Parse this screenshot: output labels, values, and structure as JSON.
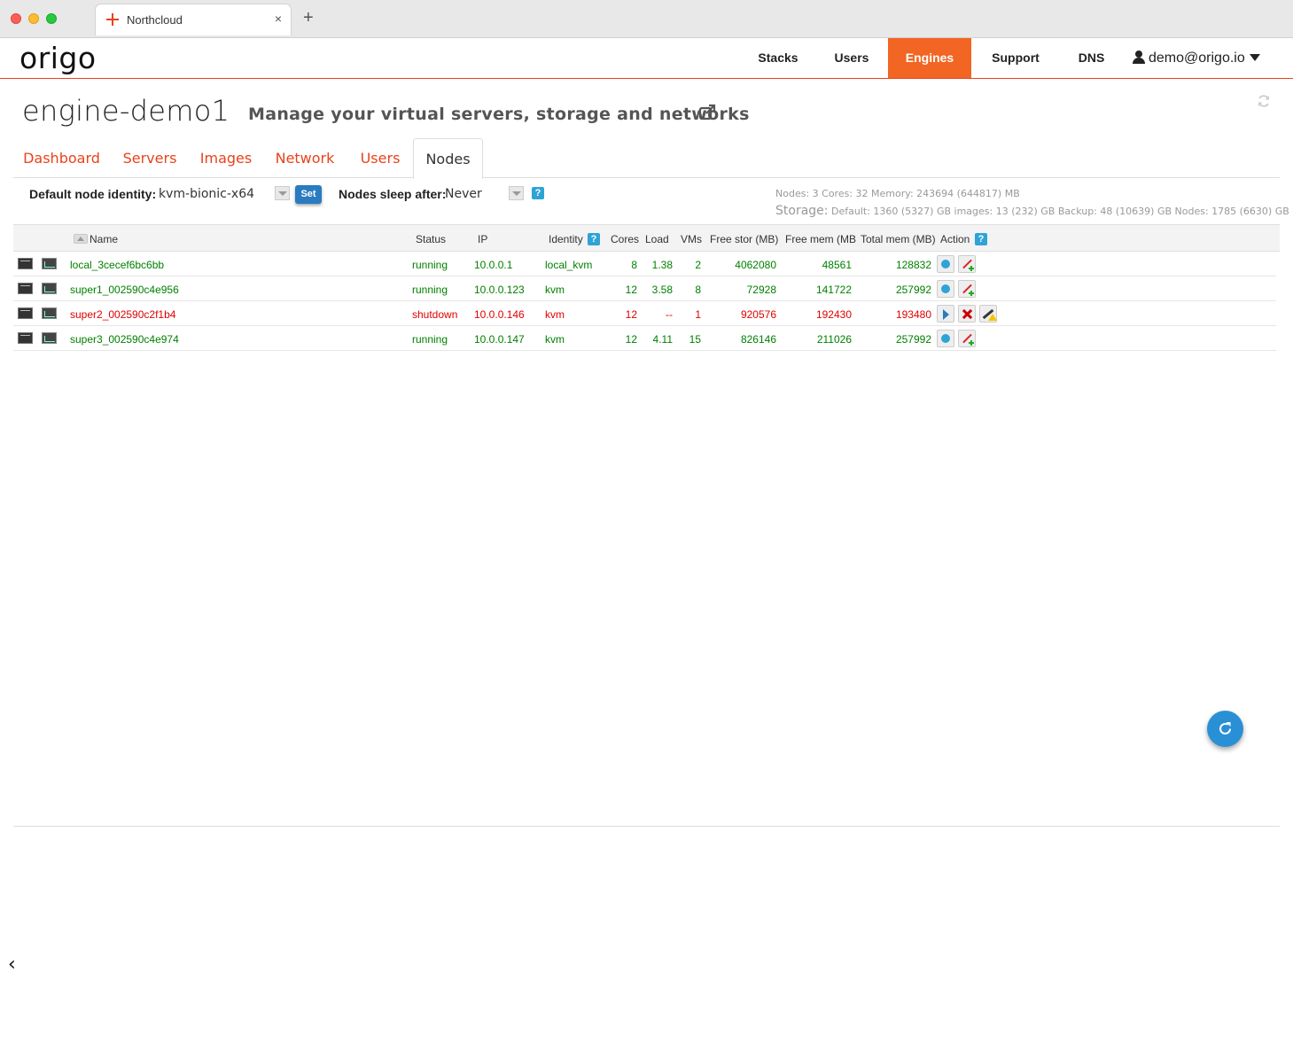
{
  "browser": {
    "tab_title": "Northcloud",
    "tab_close": "×",
    "new_tab": "+"
  },
  "header": {
    "logo": "origo",
    "nav": {
      "stacks": "Stacks",
      "users": "Users",
      "engines": "Engines",
      "support": "Support",
      "dns": "DNS",
      "account": "demo@origo.io"
    },
    "accent_color": "#f26522"
  },
  "page": {
    "title": "engine-demo1",
    "subtitle": "Manage your virtual servers, storage and networks"
  },
  "subtabs": {
    "dashboard": "Dashboard",
    "servers": "Servers",
    "images": "Images",
    "network": "Network",
    "users": "Users",
    "nodes": "Nodes",
    "active": "Nodes"
  },
  "settings": {
    "identity_label": "Default node identity:",
    "identity_value": "kvm-bionic-x64",
    "set_label": "Set",
    "sleep_label": "Nodes sleep after:",
    "sleep_value": "Never",
    "help": "?"
  },
  "stats": {
    "line1": "Nodes: 3  Cores: 32  Memory: 243694 (644817) MB",
    "line2_prefix": "Storage:",
    "line2_rest": " Default: 1360 (5327) GB  images: 13 (232) GB  Backup: 48 (10639) GB  Nodes: 1785 (6630) GB"
  },
  "table": {
    "columns": {
      "name": "Name",
      "status": "Status",
      "ip": "IP",
      "identity": "Identity",
      "cores": "Cores",
      "load": "Load",
      "vms": "VMs",
      "free_stor": "Free stor (MB)",
      "free_mem": "Free mem (MB",
      "total_mem": "Total mem (MB)",
      "action": "Action"
    },
    "rows": [
      {
        "name": "local_3cecef6bc6bb",
        "status": "running",
        "ip": "10.0.0.1",
        "identity": "local_kvm",
        "cores": "8",
        "load": "1.38",
        "vms": "2",
        "free_stor": "4062080",
        "free_mem": "48561",
        "total_mem": "128832"
      },
      {
        "name": "super1_002590c4e956",
        "status": "running",
        "ip": "10.0.0.123",
        "identity": "kvm",
        "cores": "12",
        "load": "3.58",
        "vms": "8",
        "free_stor": "72928",
        "free_mem": "141722",
        "total_mem": "257992"
      },
      {
        "name": "super2_002590c2f1b4",
        "status": "shutdown",
        "ip": "10.0.0.146",
        "identity": "kvm",
        "cores": "12",
        "load": "--",
        "vms": "1",
        "free_stor": "920576",
        "free_mem": "192430",
        "total_mem": "193480"
      },
      {
        "name": "super3_002590c4e974",
        "status": "running",
        "ip": "10.0.0.147",
        "identity": "kvm",
        "cores": "12",
        "load": "4.11",
        "vms": "15",
        "free_stor": "826146",
        "free_mem": "211026",
        "total_mem": "257992"
      }
    ],
    "status_colors": {
      "running": "#008000",
      "shutdown": "#e00000"
    }
  },
  "footer": {
    "back": "‹"
  }
}
